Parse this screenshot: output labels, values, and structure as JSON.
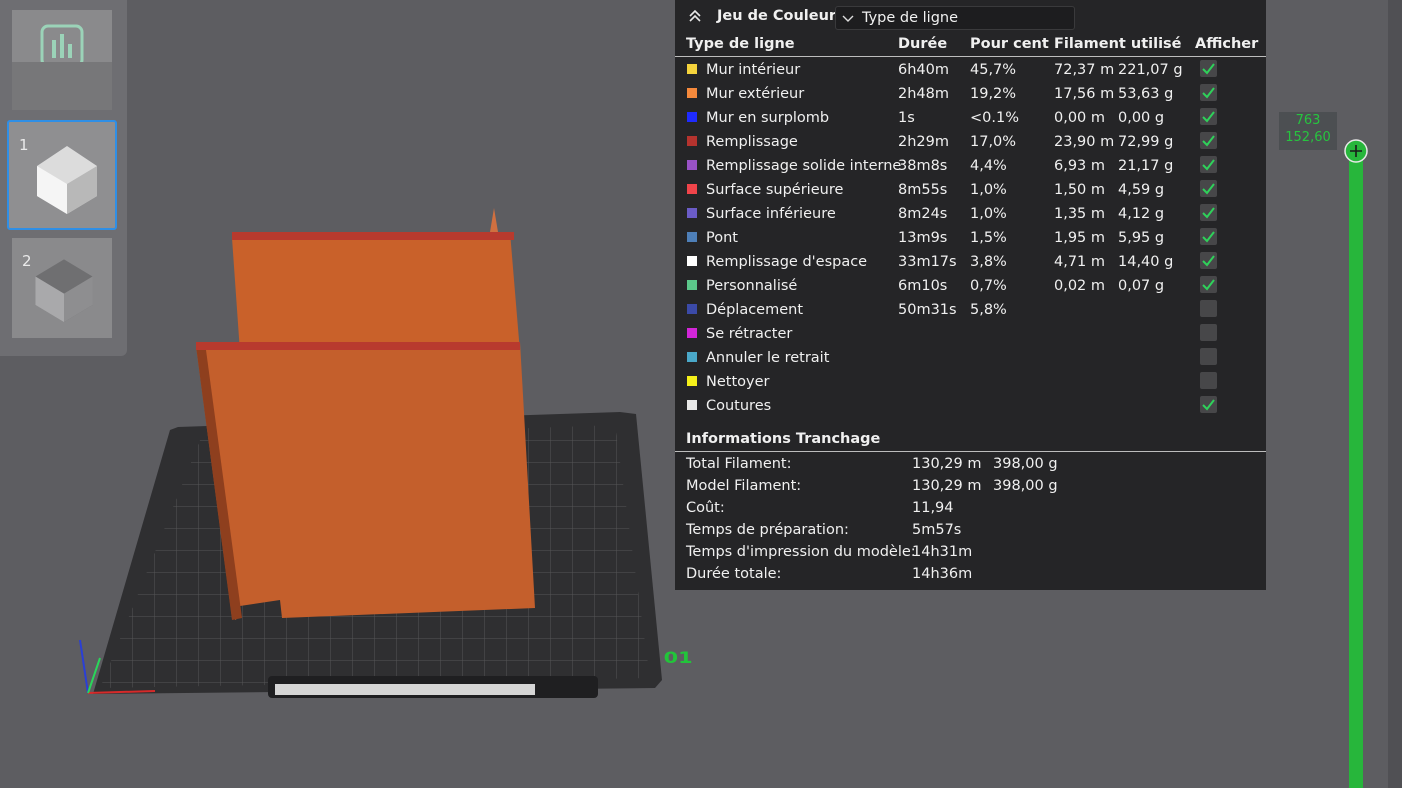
{
  "legend": {
    "title": "Jeu de Couleur",
    "view_mode": "Type de ligne",
    "headers": [
      "Type de ligne",
      "Durée",
      "Pour cent",
      "Filament utilisé",
      "Afficher"
    ],
    "rows": [
      {
        "name": "Mur intérieur",
        "duree": "6h40m",
        "pct": "45,7%",
        "len": "72,37 m",
        "weight": "221,07 g",
        "color": "#f5d33c",
        "shown": true
      },
      {
        "name": "Mur extérieur",
        "duree": "2h48m",
        "pct": "19,2%",
        "len": "17,56 m",
        "weight": "53,63 g",
        "color": "#f5893c",
        "shown": true
      },
      {
        "name": "Mur en surplomb",
        "duree": "1s",
        "pct": "<0.1%",
        "len": "0,00 m",
        "weight": "0,00 g",
        "color": "#1f2bff",
        "shown": true
      },
      {
        "name": "Remplissage",
        "duree": "2h29m",
        "pct": "17,0%",
        "len": "23,90 m",
        "weight": "72,99 g",
        "color": "#b5332e",
        "shown": true
      },
      {
        "name": "Remplissage solide interne",
        "duree": "38m8s",
        "pct": "4,4%",
        "len": "6,93 m",
        "weight": "21,17 g",
        "color": "#9a52c7",
        "shown": true
      },
      {
        "name": "Surface supérieure",
        "duree": "8m55s",
        "pct": "1,0%",
        "len": "1,50 m",
        "weight": "4,59 g",
        "color": "#f0444a",
        "shown": true
      },
      {
        "name": "Surface inférieure",
        "duree": "8m24s",
        "pct": "1,0%",
        "len": "1,35 m",
        "weight": "4,12 g",
        "color": "#6b5cc7",
        "shown": true
      },
      {
        "name": "Pont",
        "duree": "13m9s",
        "pct": "1,5%",
        "len": "1,95 m",
        "weight": "5,95 g",
        "color": "#4e7fb8",
        "shown": true
      },
      {
        "name": "Remplissage d'espace",
        "duree": "33m17s",
        "pct": "3,8%",
        "len": "4,71 m",
        "weight": "14,40 g",
        "color": "#ffffff",
        "shown": true
      },
      {
        "name": "Personnalisé",
        "duree": "6m10s",
        "pct": "0,7%",
        "len": "0,02 m",
        "weight": "0,07 g",
        "color": "#5cc78a",
        "shown": true
      },
      {
        "name": "Déplacement",
        "duree": "50m31s",
        "pct": "5,8%",
        "len": "",
        "weight": "",
        "color": "#3b4aa8",
        "shown": false
      },
      {
        "name": "Se rétracter",
        "duree": "",
        "pct": "",
        "len": "",
        "weight": "",
        "color": "#d226d8",
        "shown": false
      },
      {
        "name": "Annuler le retrait",
        "duree": "",
        "pct": "",
        "len": "",
        "weight": "",
        "color": "#4aa8c9",
        "shown": false
      },
      {
        "name": "Nettoyer",
        "duree": "",
        "pct": "",
        "len": "",
        "weight": "",
        "color": "#f5f01a",
        "shown": false
      },
      {
        "name": "Coutures",
        "duree": "",
        "pct": "",
        "len": "",
        "weight": "",
        "color": "#e8e8e8",
        "shown": true
      }
    ]
  },
  "slice_info": {
    "title": "Informations Tranchage",
    "rows": [
      {
        "label": "Total Filament:",
        "v1": "130,29 m",
        "v2": "398,00 g"
      },
      {
        "label": "Model Filament:",
        "v1": "130,29 m",
        "v2": "398,00 g"
      },
      {
        "label": "Coût:",
        "v1": "11,94",
        "v2": ""
      },
      {
        "label": "Temps de préparation:",
        "v1": "5m57s",
        "v2": ""
      },
      {
        "label": "Temps d'impression du modèle:",
        "v1": "14h31m",
        "v2": ""
      },
      {
        "label": "Durée totale:",
        "v1": "14h36m",
        "v2": ""
      }
    ]
  },
  "plates": [
    {
      "number": "1"
    },
    {
      "number": "2"
    }
  ],
  "layer_slider": {
    "layer": "763",
    "height": "152,60"
  },
  "bed": {
    "plate_label": "01"
  },
  "colors": {
    "accent_green": "#27b63b",
    "selection_blue": "#2f8fe6",
    "model_orange": "#c9612a"
  }
}
